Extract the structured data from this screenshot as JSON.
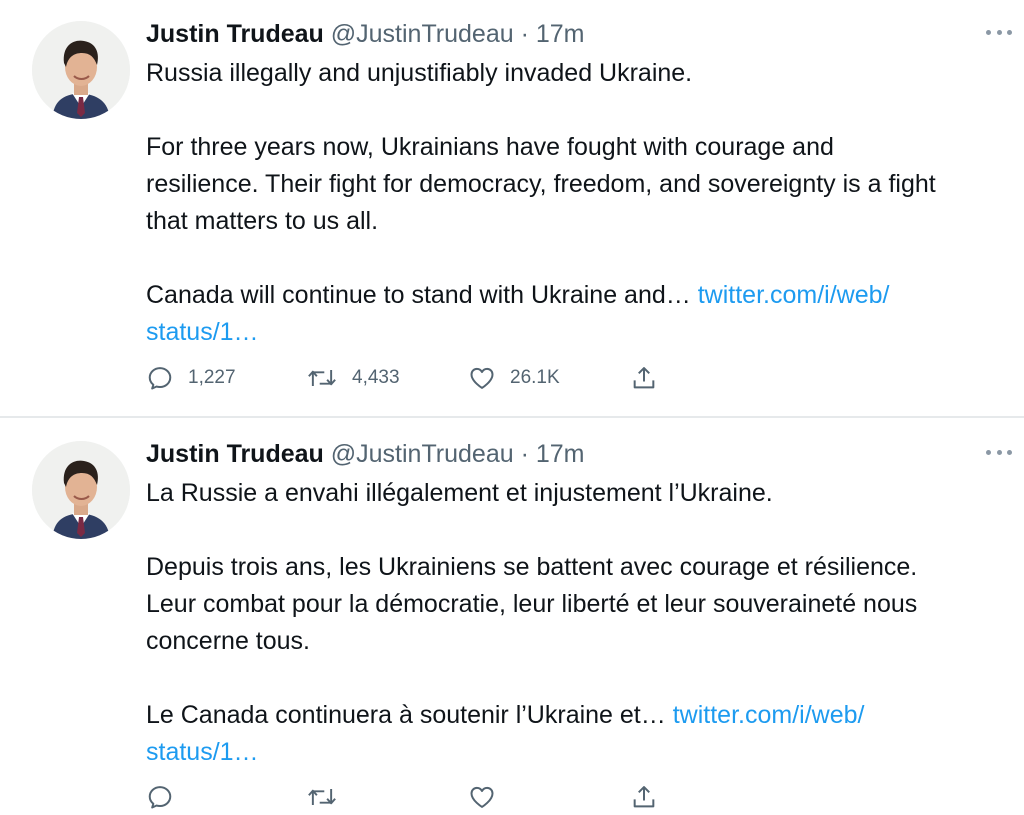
{
  "tweets": [
    {
      "author_name": "Justin Trudeau",
      "author_handle": "@JustinTrudeau",
      "separator": "·",
      "time": "17m",
      "avatar_icon": "profile-photo",
      "paragraphs": [
        "Russia illegally and unjustifiably invaded Ukraine.",
        "For three years now, Ukrainians have fought with courage and",
        "resilience. Their fight for democracy, freedom, and sovereignty is a fight",
        "that matters to us all.",
        "Canada will continue to stand with Ukraine and…"
      ],
      "link_part1": "twitter.com/i/web/",
      "link_part2": "status/1…",
      "reply_count": "1,227",
      "retweet_count": "4,433",
      "like_count": "26.1K"
    },
    {
      "author_name": "Justin Trudeau",
      "author_handle": "@JustinTrudeau",
      "separator": "·",
      "time": "17m",
      "avatar_icon": "profile-photo",
      "paragraphs": [
        "La Russie a envahi illégalement et injustement l’Ukraine.",
        "Depuis trois ans, les Ukrainiens se battent avec courage et résilience.",
        "Leur combat pour la démocratie, leur liberté et leur souveraineté nous",
        "concerne tous.",
        "Le Canada continuera à soutenir l’Ukraine et…"
      ],
      "link_part1": "twitter.com/i/web/",
      "link_part2": "status/1…"
    }
  ],
  "icons": {
    "reply": "comment-bubble-icon",
    "retweet": "retweet-icon",
    "like": "heart-icon",
    "share": "share-icon",
    "more": "more-dots-icon"
  },
  "colors": {
    "text": "#0f1419",
    "secondary": "#536471",
    "link": "#1d9bf0",
    "divider": "#e6e9eb"
  }
}
